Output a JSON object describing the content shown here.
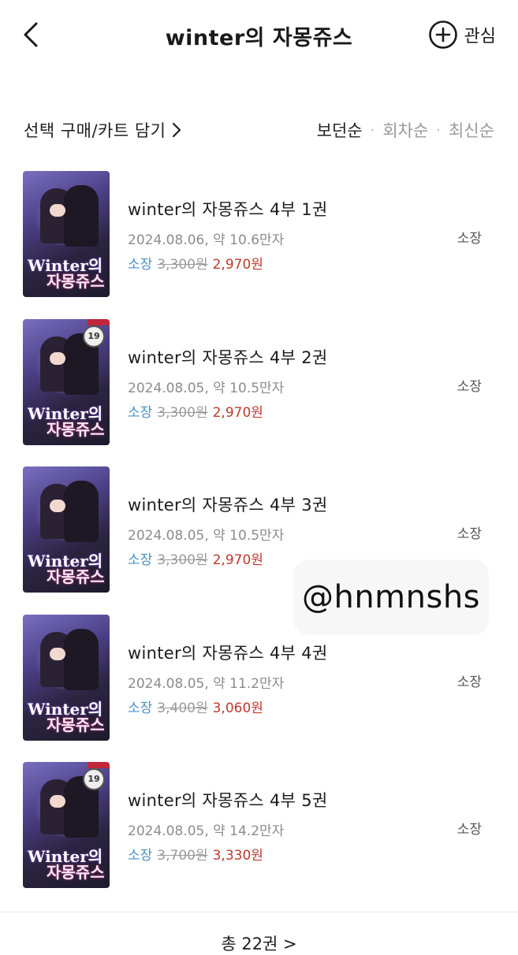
{
  "header": {
    "title": "winter의 자몽쥬스",
    "favorite_label": "관심",
    "icons": {
      "back": "chevron-left-icon",
      "favorite": "plus-circle-icon"
    }
  },
  "toolbar": {
    "select_buy_label": "선택 구매/카트 담기",
    "sort_options": [
      "보던순",
      "회차순",
      "최신순"
    ],
    "active_sort": "보던순"
  },
  "items": [
    {
      "title": "winter의 자몽쥬스 4부 1권",
      "meta": "2024.08.06, 약 10.6만자",
      "price_label": "소장",
      "original_price": "3,300원",
      "sale_price": "2,970원",
      "status": "소장"
    },
    {
      "title": "winter의 자몽쥬스 4부 2권",
      "meta": "2024.08.05, 약 10.5만자",
      "price_label": "소장",
      "original_price": "3,300원",
      "sale_price": "2,970원",
      "status": "소장"
    },
    {
      "title": "winter의 자몽쥬스 4부 3권",
      "meta": "2024.08.05, 약 10.5만자",
      "price_label": "소장",
      "original_price": "3,300원",
      "sale_price": "2,970원",
      "status": "소장"
    },
    {
      "title": "winter의 자몽쥬스 4부 4권",
      "meta": "2024.08.05, 약 11.2만자",
      "price_label": "소장",
      "original_price": "3,400원",
      "sale_price": "3,060원",
      "status": "소장"
    },
    {
      "title": "winter의 자몽쥬스 4부 5권",
      "meta": "2024.08.05, 약 14.2만자",
      "price_label": "소장",
      "original_price": "3,700원",
      "sale_price": "3,330원",
      "status": "소장"
    }
  ],
  "cover": {
    "title_line1": "Winter의",
    "title_line2": "자몽쥬스",
    "badge": "19"
  },
  "watermark": "@hnmnshs",
  "footer": {
    "more_label": "총 22권 >"
  },
  "colors": {
    "price_label": "#4a90c8",
    "sale_price": "#c0392b",
    "original_price": "#9a9a9a"
  }
}
